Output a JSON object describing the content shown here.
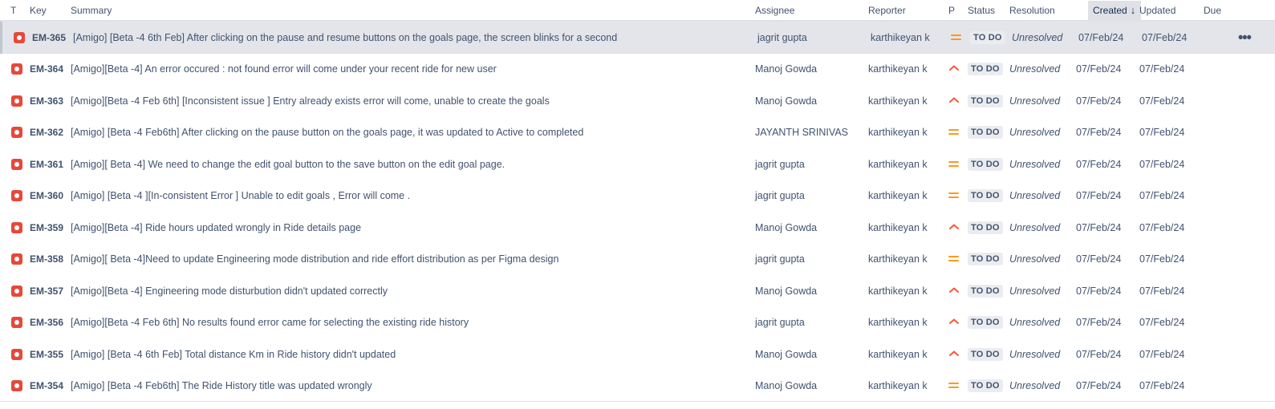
{
  "columns": {
    "type": "T",
    "key": "Key",
    "summary": "Summary",
    "assignee": "Assignee",
    "reporter": "Reporter",
    "priority": "P",
    "status": "Status",
    "resolution": "Resolution",
    "created": "Created",
    "updated": "Updated",
    "due": "Due"
  },
  "sort": {
    "column": "created",
    "direction": "descending"
  },
  "colors": {
    "bug": "#e5493a",
    "priority_medium": "#ff991f",
    "priority_high": "#ff5630",
    "selected_row": "#e3e5ea"
  },
  "rows": [
    {
      "key": "EM-365",
      "summary": "[Amigo] [Beta -4 6th Feb] After clicking on the pause and resume buttons on the goals page, the screen blinks for a second",
      "assignee": "jagrit gupta",
      "reporter": "karthikeyan k",
      "priority": "medium",
      "status": "TO DO",
      "resolution": "Unresolved",
      "created": "07/Feb/24",
      "updated": "07/Feb/24",
      "due": "",
      "selected": true
    },
    {
      "key": "EM-364",
      "summary": "[Amigo][Beta -4] An error occured : not found error will come under your recent ride for new user",
      "assignee": "Manoj Gowda",
      "reporter": "karthikeyan k",
      "priority": "high",
      "status": "TO DO",
      "resolution": "Unresolved",
      "created": "07/Feb/24",
      "updated": "07/Feb/24",
      "due": ""
    },
    {
      "key": "EM-363",
      "summary": "[Amigo][Beta -4 Feb 6th] [Inconsistent issue ] Entry already exists error will come, unable to create the goals",
      "assignee": "Manoj Gowda",
      "reporter": "karthikeyan k",
      "priority": "high",
      "status": "TO DO",
      "resolution": "Unresolved",
      "created": "07/Feb/24",
      "updated": "07/Feb/24",
      "due": ""
    },
    {
      "key": "EM-362",
      "summary": "[Amigo] [Beta -4 Feb6th] After clicking on the pause button on the goals page, it was updated to Active to completed",
      "assignee": "JAYANTH SRINIVAS",
      "reporter": "karthikeyan k",
      "priority": "medium",
      "status": "TO DO",
      "resolution": "Unresolved",
      "created": "07/Feb/24",
      "updated": "07/Feb/24",
      "due": ""
    },
    {
      "key": "EM-361",
      "summary": "[Amigo][ Beta -4] We need to change the edit goal button to the save button on the edit goal page.",
      "assignee": "jagrit gupta",
      "reporter": "karthikeyan k",
      "priority": "medium",
      "status": "TO DO",
      "resolution": "Unresolved",
      "created": "07/Feb/24",
      "updated": "07/Feb/24",
      "due": ""
    },
    {
      "key": "EM-360",
      "summary": "[Amigo] [Beta -4 ][In-consistent Error ] Unable to edit goals , Error will come .",
      "assignee": "jagrit gupta",
      "reporter": "karthikeyan k",
      "priority": "medium",
      "status": "TO DO",
      "resolution": "Unresolved",
      "created": "07/Feb/24",
      "updated": "07/Feb/24",
      "due": ""
    },
    {
      "key": "EM-359",
      "summary": "[Amigo][Beta -4] Ride hours updated wrongly in Ride details page",
      "assignee": "Manoj Gowda",
      "reporter": "karthikeyan k",
      "priority": "high",
      "status": "TO DO",
      "resolution": "Unresolved",
      "created": "07/Feb/24",
      "updated": "07/Feb/24",
      "due": ""
    },
    {
      "key": "EM-358",
      "summary": "[Amigo][ Beta -4]Need to update Engineering mode distribution and ride effort distribution as per Figma design",
      "assignee": "jagrit gupta",
      "reporter": "karthikeyan k",
      "priority": "medium",
      "status": "TO DO",
      "resolution": "Unresolved",
      "created": "07/Feb/24",
      "updated": "07/Feb/24",
      "due": ""
    },
    {
      "key": "EM-357",
      "summary": "[Amigo][Beta -4] Engineering mode disturbution didn't updated correctly",
      "assignee": "Manoj Gowda",
      "reporter": "karthikeyan k",
      "priority": "high",
      "status": "TO DO",
      "resolution": "Unresolved",
      "created": "07/Feb/24",
      "updated": "07/Feb/24",
      "due": ""
    },
    {
      "key": "EM-356",
      "summary": "[Amigo][Beta -4 Feb 6th] No results found error came for selecting the existing ride history",
      "assignee": "jagrit gupta",
      "reporter": "karthikeyan k",
      "priority": "high",
      "status": "TO DO",
      "resolution": "Unresolved",
      "created": "07/Feb/24",
      "updated": "07/Feb/24",
      "due": ""
    },
    {
      "key": "EM-355",
      "summary": "[Amigo] [Beta -4 6th Feb] Total distance Km in Ride history didn't updated",
      "assignee": "Manoj Gowda",
      "reporter": "karthikeyan k",
      "priority": "high",
      "status": "TO DO",
      "resolution": "Unresolved",
      "created": "07/Feb/24",
      "updated": "07/Feb/24",
      "due": ""
    },
    {
      "key": "EM-354",
      "summary": "[Amigo] [Beta -4 Feb6th] The Ride History title was updated wrongly",
      "assignee": "Manoj Gowda",
      "reporter": "karthikeyan k",
      "priority": "medium",
      "status": "TO DO",
      "resolution": "Unresolved",
      "created": "07/Feb/24",
      "updated": "07/Feb/24",
      "due": ""
    }
  ],
  "row_actions": {
    "more_label": "•••"
  }
}
